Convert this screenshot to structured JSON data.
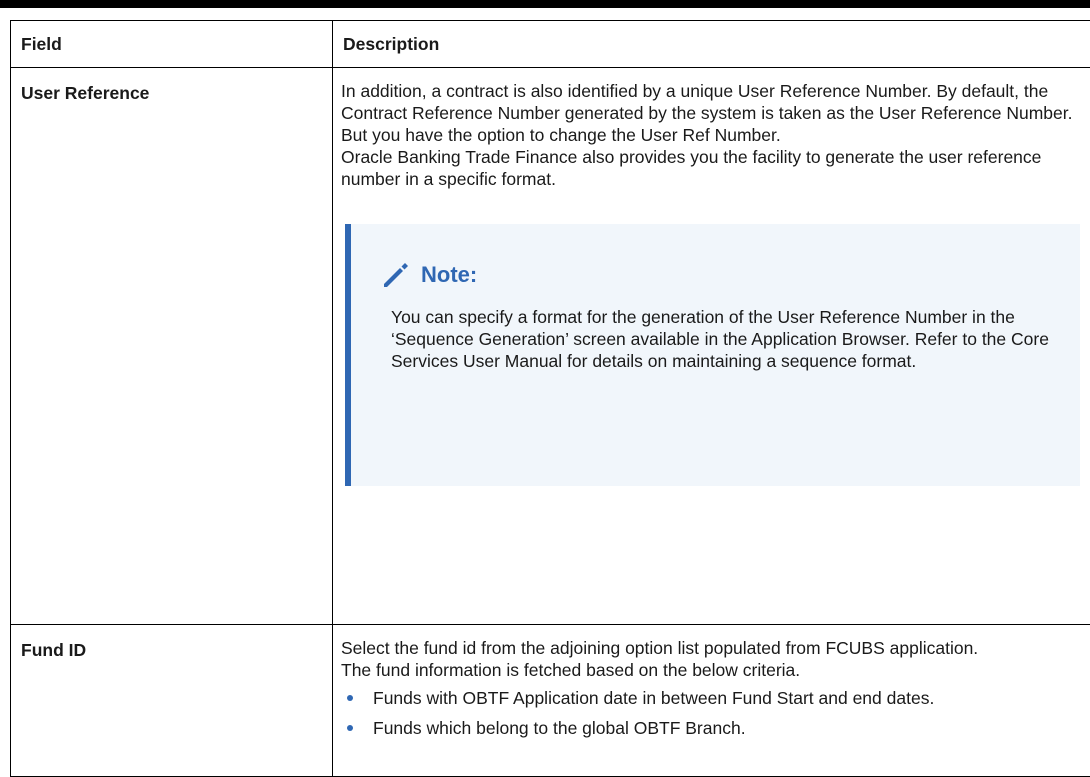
{
  "table": {
    "header": {
      "field": "Field",
      "description": "Description"
    },
    "rows": [
      {
        "field": "User Reference",
        "paragraphs": [
          "In addition, a contract is also identified by a unique User Reference Number. By default, the Contract Reference Number generated by the system is taken as the User Reference Number. But you have the option to change the User Ref Number.",
          "Oracle Banking Trade Finance also provides you the facility to generate the user reference number in a specific format."
        ],
        "note": {
          "icon": "pencil-icon",
          "title": "Note:",
          "body": "You can specify a format for the generation of the User Reference Number in the ‘Sequence Generation’ screen available in the Application Browser. Refer to the Core Services User Manual for details on maintaining a sequence format."
        }
      },
      {
        "field": "Fund ID",
        "paragraphs": [
          "Select the fund id from the adjoining option list populated from FCUBS application.",
          "The fund information is fetched based on the below criteria."
        ],
        "bullets": [
          "Funds with OBTF Application date in between Fund Start and end dates.",
          "Funds which belong to the global OBTF Branch."
        ]
      }
    ]
  },
  "colors": {
    "accent": "#2f67b3",
    "note_background": "#f1f6fb"
  }
}
